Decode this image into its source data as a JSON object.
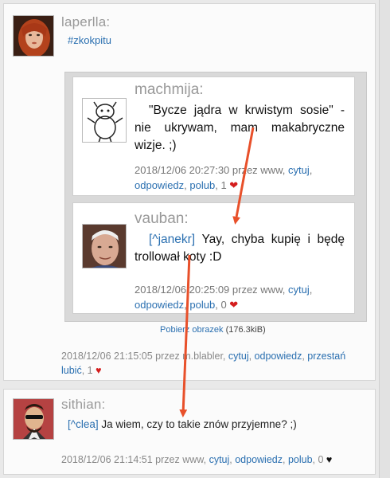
{
  "posts": [
    {
      "username": "laperlla:",
      "tag": "#zkokpitu",
      "embed": {
        "comments": [
          {
            "username": "machmija:",
            "text": "\"Bycze jądra w krwistym sosie\" - nie ukrywam, mam makabryczne wizje. ;)",
            "meta": "2018/12/06   20:27:30  przez  www,",
            "actions": {
              "quote": "cytuj",
              "reply": "odpowiedz",
              "like": "polub"
            },
            "likes": "1"
          },
          {
            "username": "vauban:",
            "reply_to": "[^janekr]",
            "text": " Yay, chyba kupię i będę trollował koty :D",
            "meta": "2018/12/06   20:25:09  przez  www,",
            "actions": {
              "quote": "cytuj",
              "reply": "odpowiedz",
              "like": "polub"
            },
            "likes": "0"
          }
        ],
        "download_label": "Pobierz obrazek",
        "download_size": "(176.3kiB)"
      },
      "meta": "2018/12/06 21:15:05 przez m.blabler,",
      "actions": {
        "quote": "cytuj",
        "reply": "odpowiedz",
        "stop_liking": "przestań lubić"
      },
      "likes": "1"
    },
    {
      "username": "sithian:",
      "reply_to": "[^clea]",
      "text": " Ja wiem, czy to takie znów przyjemne? ;)",
      "meta": "2018/12/06 21:14:51 przez www,",
      "actions": {
        "quote": "cytuj",
        "reply": "odpowiedz",
        "like": "polub"
      },
      "likes": "0"
    }
  ],
  "colors": {
    "link": "#2a6fb0",
    "heart": "#d41d1d",
    "arrow": "#e8502a"
  },
  "icons": {
    "heart_filled": "heart-icon",
    "heart_black": "heart-icon"
  }
}
